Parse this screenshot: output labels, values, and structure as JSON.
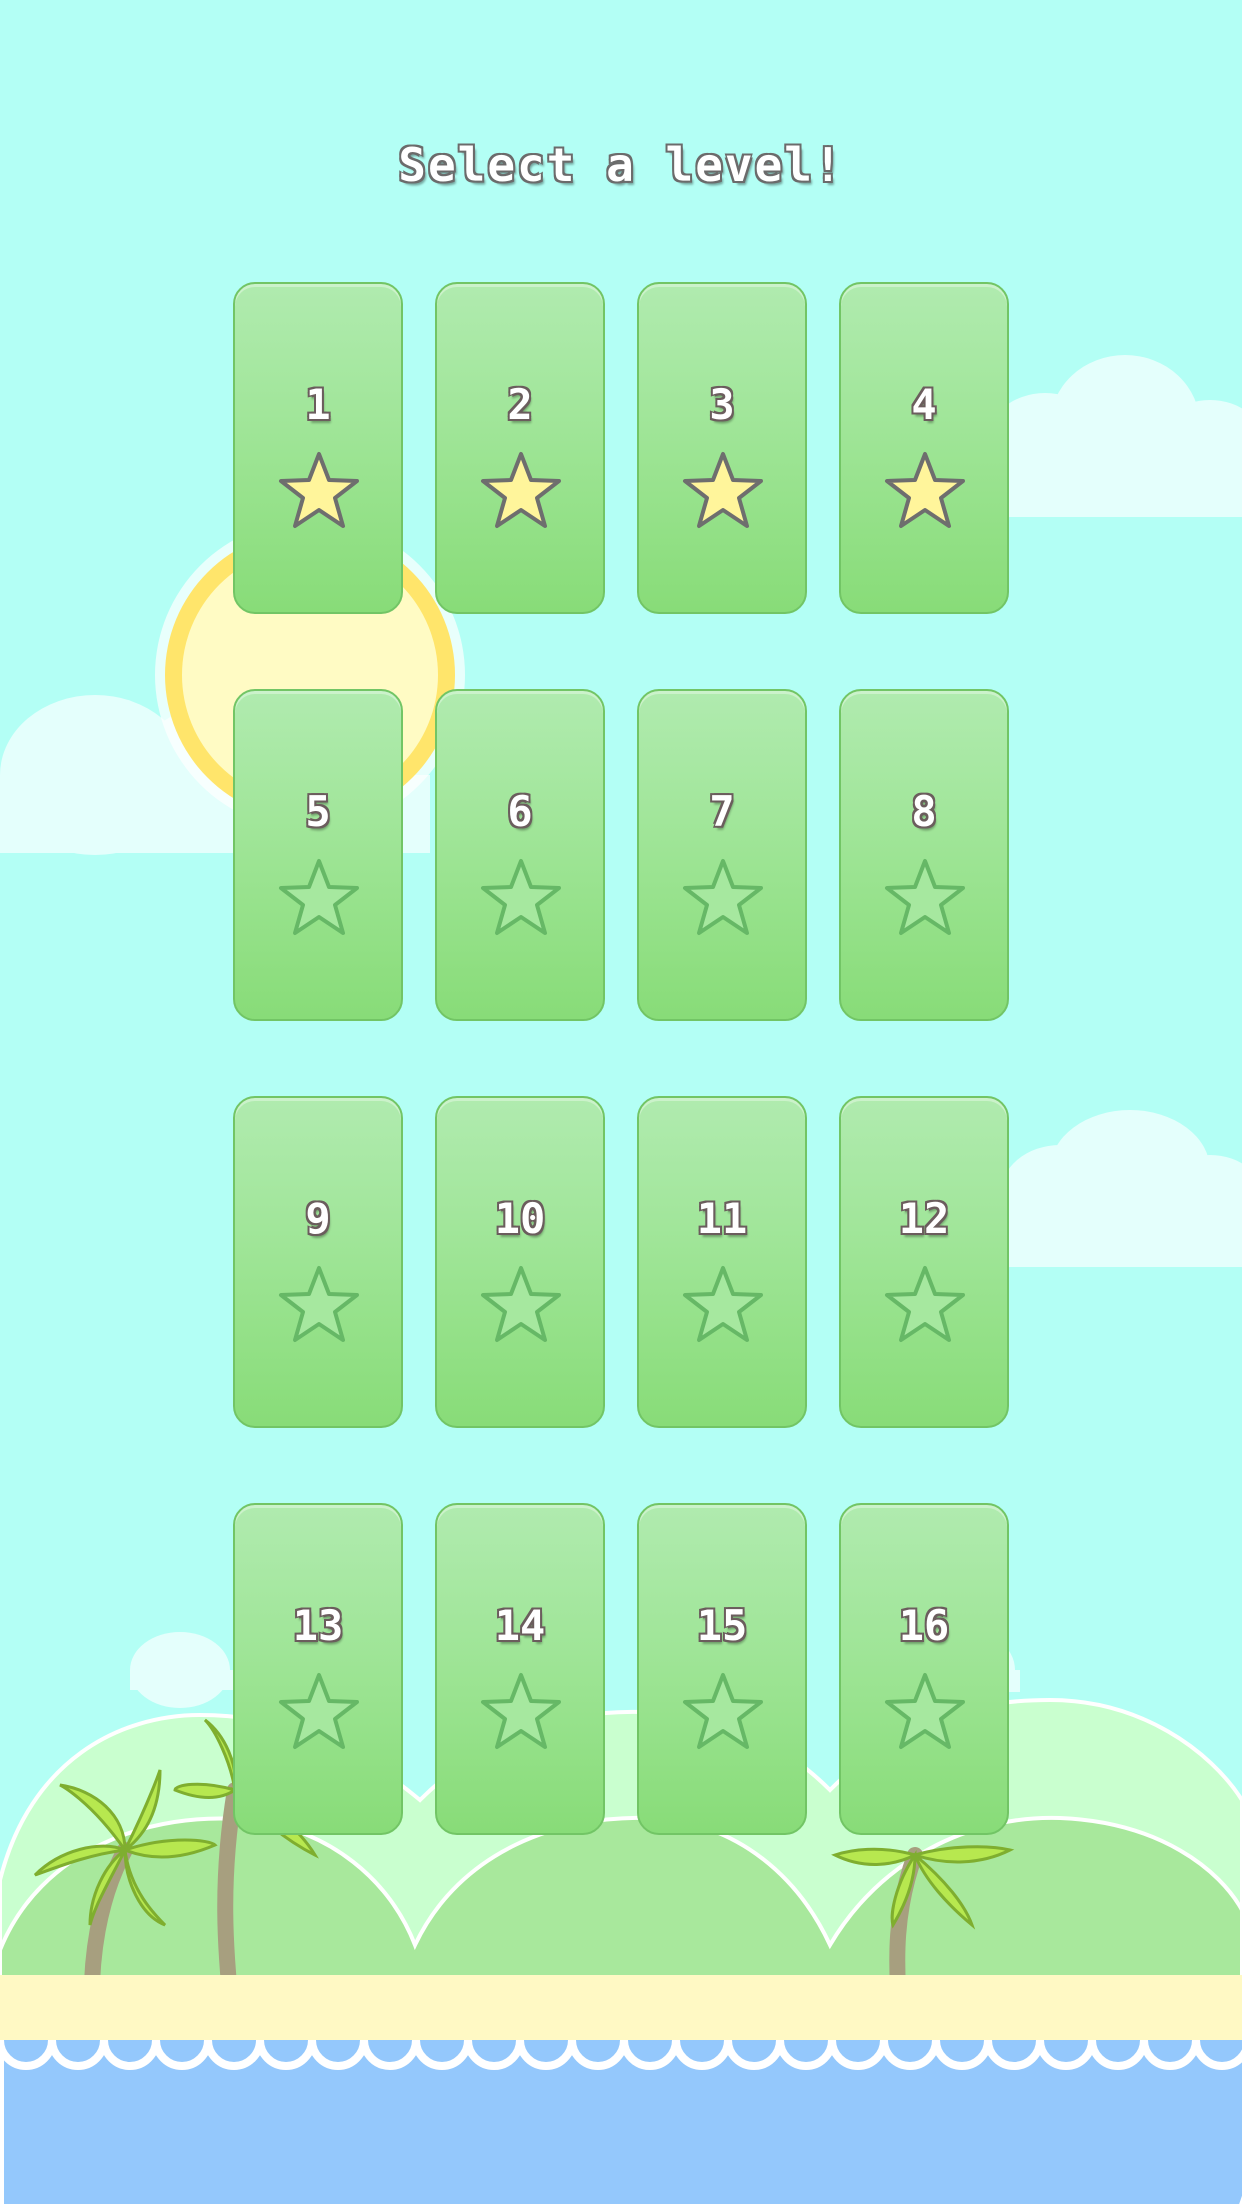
{
  "title": "Select a level!",
  "levels": [
    {
      "number": "1",
      "completed": true
    },
    {
      "number": "2",
      "completed": true
    },
    {
      "number": "3",
      "completed": true
    },
    {
      "number": "4",
      "completed": true
    },
    {
      "number": "5",
      "completed": false
    },
    {
      "number": "6",
      "completed": false
    },
    {
      "number": "7",
      "completed": false
    },
    {
      "number": "8",
      "completed": false
    },
    {
      "number": "9",
      "completed": false
    },
    {
      "number": "10",
      "completed": false
    },
    {
      "number": "11",
      "completed": false
    },
    {
      "number": "12",
      "completed": false
    },
    {
      "number": "13",
      "completed": false
    },
    {
      "number": "14",
      "completed": false
    },
    {
      "number": "15",
      "completed": false
    },
    {
      "number": "16",
      "completed": false
    }
  ],
  "icons": {
    "earned_star": "star-icon",
    "empty_star": "star-outline-icon"
  },
  "colors": {
    "sky": "#b3fff5",
    "tile": "#9fe597",
    "star_earned": "#fff59b",
    "star_empty": "#66b866",
    "sea": "#94c8fc",
    "sand": "#fff9c4",
    "hills": "#a8e89c",
    "sun": "#ffe56b"
  }
}
